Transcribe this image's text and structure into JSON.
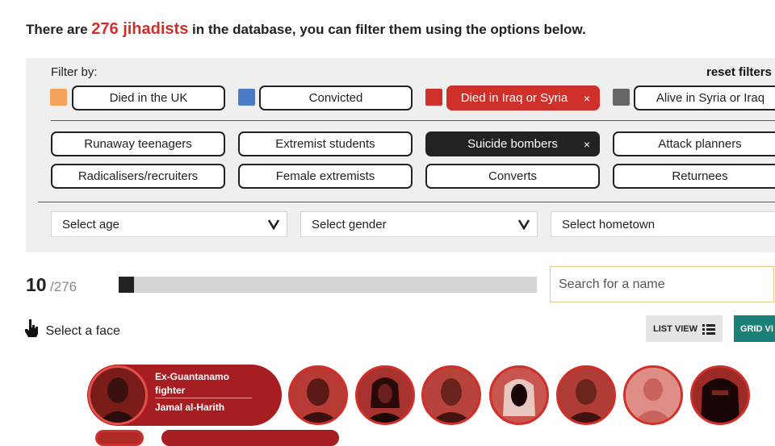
{
  "headline": {
    "prefix": "There are ",
    "count_text": "276 jihadists",
    "suffix": " in the database, you can filter them using the options below."
  },
  "filters": {
    "label": "Filter by:",
    "reset_label": "reset filters",
    "status": [
      {
        "label": "Died in the UK",
        "color": "#f7a25a",
        "active": false
      },
      {
        "label": "Convicted",
        "color": "#4a7cc7",
        "active": false
      },
      {
        "label": "Died in Iraq or Syria",
        "color": "#d0302a",
        "active": true
      },
      {
        "label": "Alive in Syria or Iraq",
        "color": "#666666",
        "active": false
      }
    ],
    "categories": [
      {
        "label": "Runaway teenagers",
        "active": false
      },
      {
        "label": "Extremist students",
        "active": false
      },
      {
        "label": "Suicide bombers",
        "active": true
      },
      {
        "label": "Attack planners",
        "active": false
      },
      {
        "label": "Radicalisers/recruiters",
        "active": false
      },
      {
        "label": "Female extremists",
        "active": false
      },
      {
        "label": "Converts",
        "active": false
      },
      {
        "label": "Returnees",
        "active": false
      }
    ],
    "close_glyph": "×",
    "selects": {
      "age": "Select age",
      "gender": "Select gender",
      "hometown": "Select hometown"
    }
  },
  "results": {
    "shown": "10",
    "total": "/276",
    "progress_fraction": 0.0362
  },
  "search": {
    "placeholder": "Search for a name"
  },
  "hint": "Select a face",
  "views": {
    "list_label": "LIST VIEW",
    "grid_label": "GRID VI"
  },
  "featured": {
    "label": "Ex-Guantanamo fighter",
    "name": "Jamal al-Harith"
  },
  "colors": {
    "accent_red": "#d0302a",
    "dark_red": "#a61e22",
    "teal": "#1b8178",
    "panel_bg": "#efefef"
  }
}
